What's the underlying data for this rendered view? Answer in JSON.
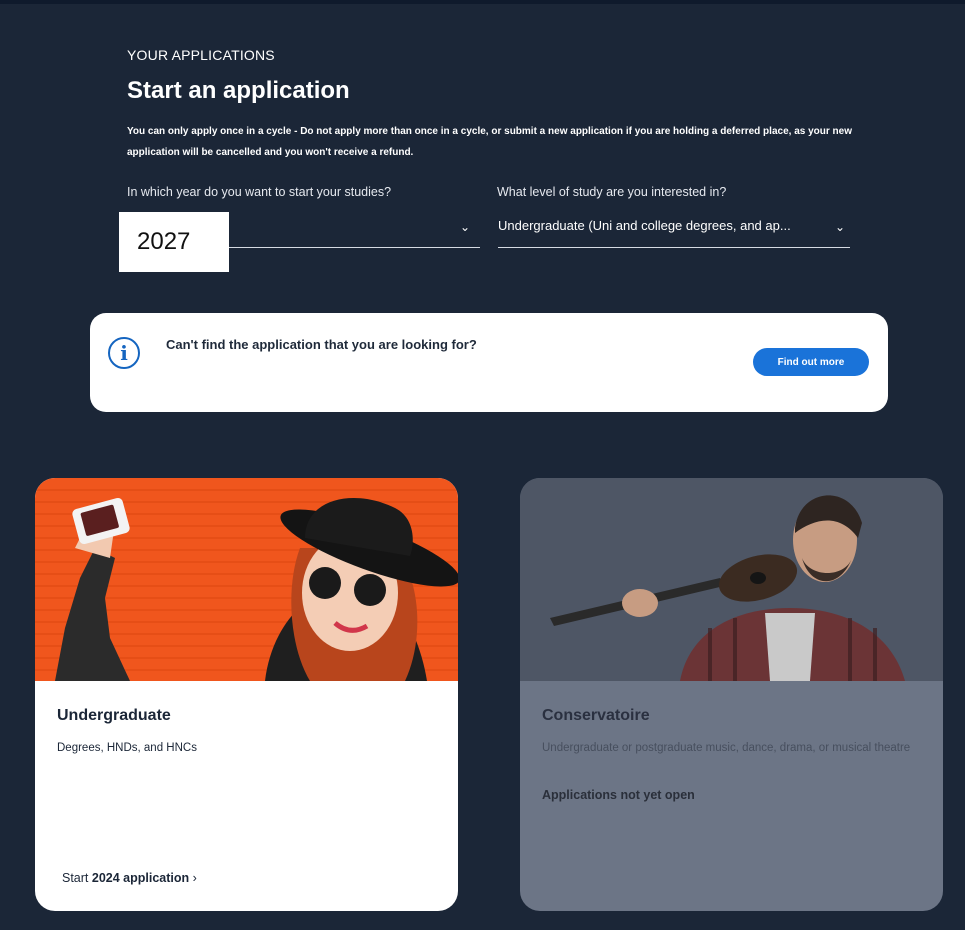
{
  "header": {
    "eyebrow": "YOUR APPLICATIONS",
    "title": "Start an application",
    "notice": "You can only apply once in a cycle - Do not apply more than once in a cycle, or submit a new application if you are holding a deferred place, as your new application will be cancelled and you won't receive a refund."
  },
  "form": {
    "year_label": "In which year do you want to start your studies?",
    "year_value": "2027",
    "level_label": "What level of study are you interested in?",
    "level_value": "Undergraduate (Uni and college degrees, and ap..."
  },
  "info": {
    "text": "Can't find the application that you are looking for?",
    "button": "Find out more"
  },
  "cards": {
    "undergraduate": {
      "title": "Undergraduate",
      "description": "Degrees, HNDs, and HNCs",
      "link_prefix": "Start",
      "link_bold": "2024 application",
      "link_suffix": " ›"
    },
    "conservatoire": {
      "title": "Conservatoire",
      "description": "Undergraduate or postgraduate music, dance, drama, or musical theatre",
      "note": "Applications not yet open"
    }
  },
  "icons": {
    "info": "info-icon",
    "chevron": "chevron-down-icon"
  },
  "colors": {
    "background": "#1b2637",
    "accent": "#1a73d9",
    "ug_image_bg": "#f0561d",
    "conservatoire_bg": "#6c7586"
  }
}
